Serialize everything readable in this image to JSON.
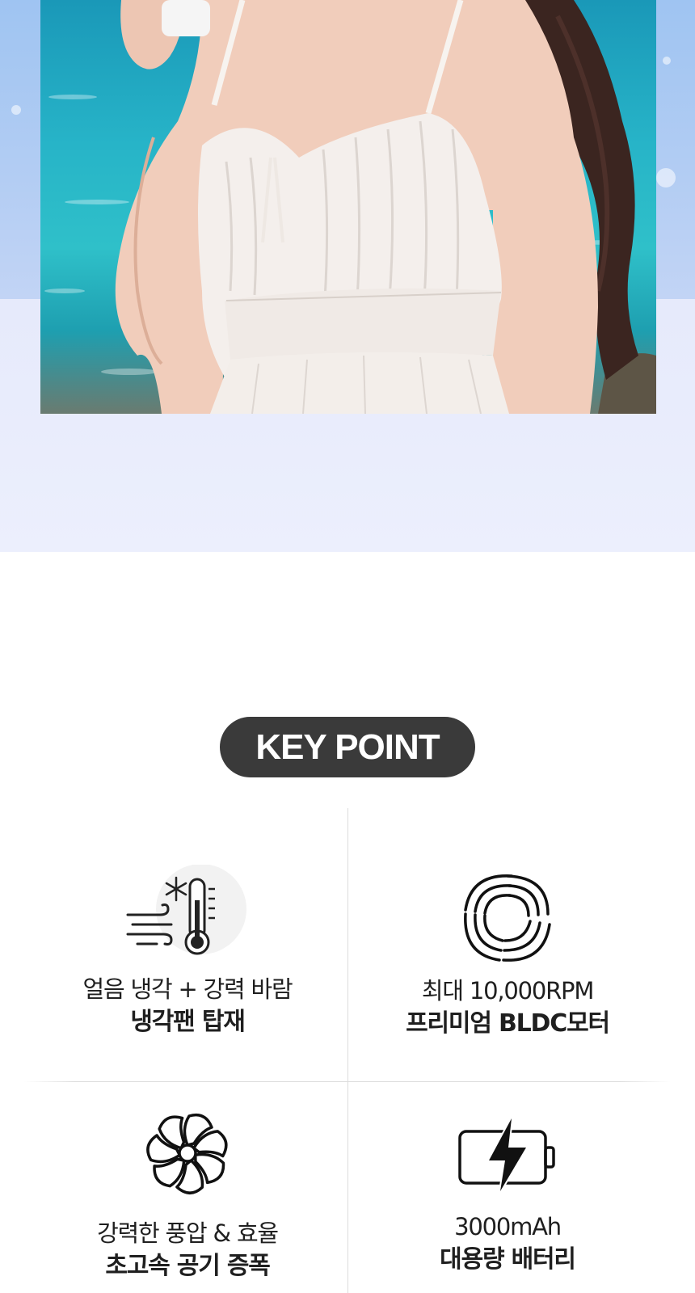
{
  "hero": {
    "accent_top": "#9fc4f2",
    "accent_bottom": "#eceffd",
    "photo": "woman-in-white-dress-by-sea"
  },
  "key_point": {
    "badge_label": "KEY POINT",
    "badge_color": "#3a3a3a",
    "features": [
      {
        "icon": "wind-thermometer-snowflake-icon",
        "line1": "얼음 냉각 + 강력 바람",
        "line2": "냉각팬 탑재"
      },
      {
        "icon": "vortex-icon",
        "line1": "최대 10,000RPM",
        "line2": "프리미엄 BLDC모터"
      },
      {
        "icon": "fan-blade-icon",
        "line1": "강력한 풍압 & 효율",
        "line2": "초고속 공기 증폭"
      },
      {
        "icon": "battery-charging-icon",
        "line1": "3000mAh",
        "line2": "대용량 배터리"
      }
    ]
  }
}
